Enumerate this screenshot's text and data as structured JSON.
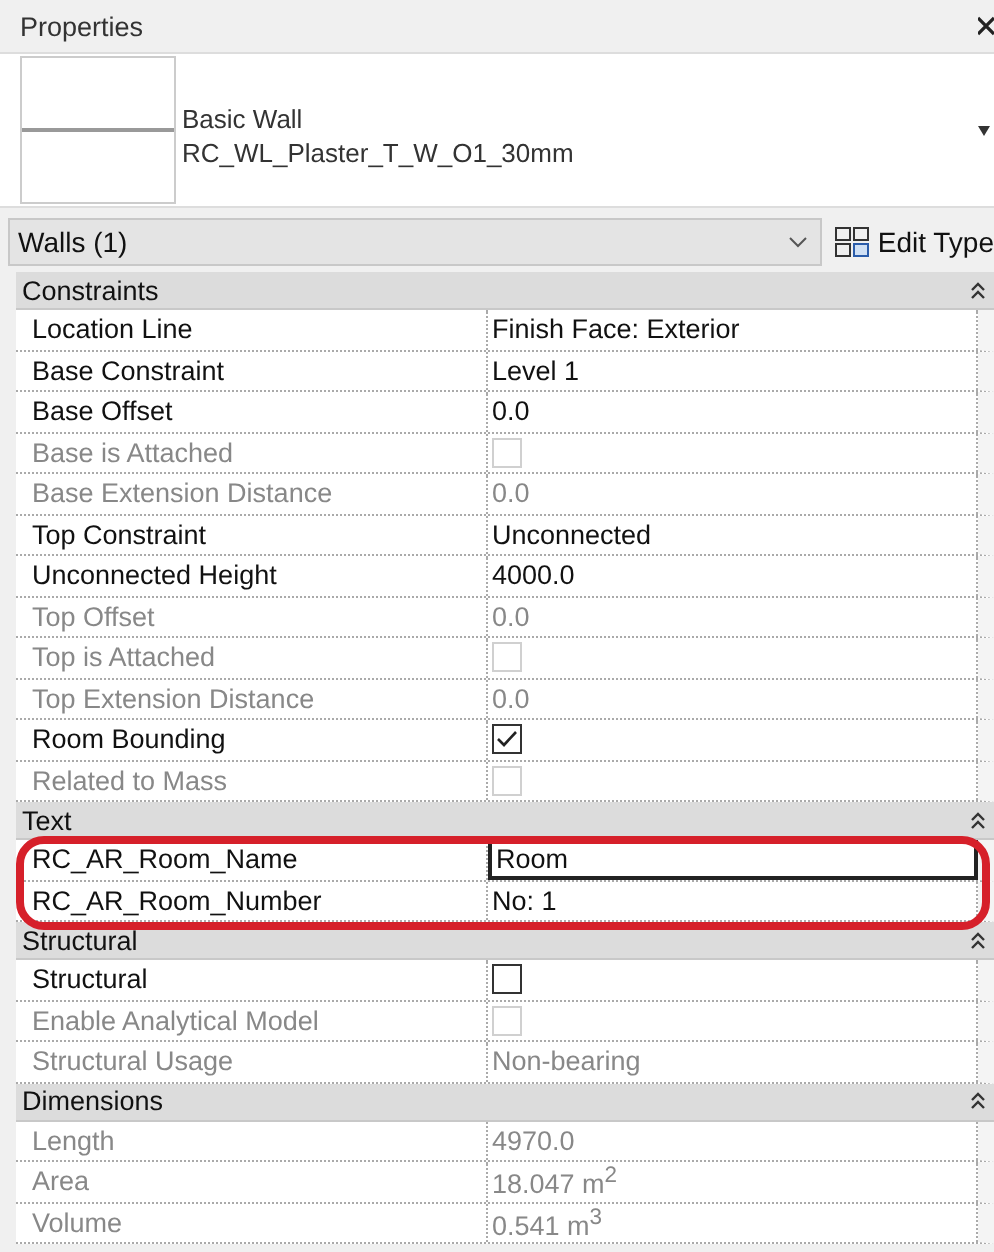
{
  "window": {
    "title": "Properties"
  },
  "type_selector": {
    "family": "Basic Wall",
    "type": "RC_WL_Plaster_T_W_O1_30mm"
  },
  "filter": {
    "value": "Walls (1)",
    "button": "Edit Type"
  },
  "groups": [
    {
      "title": "Constraints",
      "expanded": true,
      "highlighted": false,
      "rows": [
        {
          "label": "Location Line",
          "kind": "text",
          "value": "Finish Face: Exterior",
          "disabled": false,
          "editing": false
        },
        {
          "label": "Base Constraint",
          "kind": "text",
          "value": "Level 1",
          "disabled": false,
          "editing": false
        },
        {
          "label": "Base Offset",
          "kind": "text",
          "value": "0.0",
          "disabled": false,
          "editing": false
        },
        {
          "label": "Base is Attached",
          "kind": "checkbox",
          "checked": false,
          "disabled": true
        },
        {
          "label": "Base Extension Distance",
          "kind": "text",
          "value": "0.0",
          "disabled": true,
          "editing": false
        },
        {
          "label": "Top Constraint",
          "kind": "text",
          "value": "Unconnected",
          "disabled": false,
          "editing": false
        },
        {
          "label": "Unconnected Height",
          "kind": "text",
          "value": "4000.0",
          "disabled": false,
          "editing": false
        },
        {
          "label": "Top Offset",
          "kind": "text",
          "value": "0.0",
          "disabled": true,
          "editing": false
        },
        {
          "label": "Top is Attached",
          "kind": "checkbox",
          "checked": false,
          "disabled": true
        },
        {
          "label": "Top Extension Distance",
          "kind": "text",
          "value": "0.0",
          "disabled": true,
          "editing": false
        },
        {
          "label": "Room Bounding",
          "kind": "checkbox",
          "checked": true,
          "disabled": false
        },
        {
          "label": "Related to Mass",
          "kind": "checkbox",
          "checked": false,
          "disabled": true
        }
      ]
    },
    {
      "title": "Text",
      "expanded": true,
      "highlighted": true,
      "rows": [
        {
          "label": "RC_AR_Room_Name",
          "kind": "text",
          "value": "Room",
          "disabled": false,
          "editing": true
        },
        {
          "label": "RC_AR_Room_Number",
          "kind": "text",
          "value": "No: 1",
          "disabled": false,
          "editing": false
        }
      ]
    },
    {
      "title": "Structural",
      "expanded": true,
      "highlighted": false,
      "rows": [
        {
          "label": "Structural",
          "kind": "checkbox",
          "checked": false,
          "disabled": false
        },
        {
          "label": "Enable Analytical Model",
          "kind": "checkbox",
          "checked": false,
          "disabled": true
        },
        {
          "label": "Structural Usage",
          "kind": "text",
          "value": "Non-bearing",
          "disabled": true,
          "editing": false
        }
      ]
    },
    {
      "title": "Dimensions",
      "expanded": true,
      "highlighted": false,
      "rows": [
        {
          "label": "Length",
          "kind": "text",
          "value": "4970.0",
          "disabled": true,
          "editing": false
        },
        {
          "label": "Area",
          "kind": "text",
          "value": "18.047 m$^{2}$",
          "disabled": true,
          "editing": false
        },
        {
          "label": "Volume",
          "kind": "text",
          "value": "0.541 m$^{3}$",
          "disabled": true,
          "editing": false
        }
      ]
    }
  ]
}
